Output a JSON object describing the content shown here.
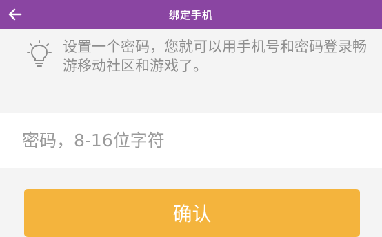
{
  "header": {
    "title": "绑定手机",
    "back_icon": "arrow-left-icon",
    "background": "#8a45a2"
  },
  "tip": {
    "icon": "lightbulb-icon",
    "text": "设置一个密码，您就可以用手机号和密码登录畅游移动社区和游戏了。"
  },
  "password_field": {
    "placeholder": "密码，8-16位字符",
    "value": ""
  },
  "confirm_button": {
    "label": "确认",
    "background": "#f4b43d"
  }
}
